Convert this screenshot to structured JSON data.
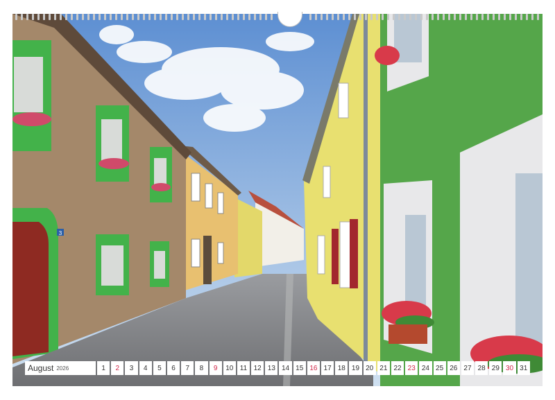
{
  "calendar": {
    "month": "August",
    "year": "2026",
    "days": [
      {
        "n": "1",
        "sun": false
      },
      {
        "n": "2",
        "sun": true
      },
      {
        "n": "3",
        "sun": false
      },
      {
        "n": "4",
        "sun": false
      },
      {
        "n": "5",
        "sun": false
      },
      {
        "n": "6",
        "sun": false
      },
      {
        "n": "7",
        "sun": false
      },
      {
        "n": "8",
        "sun": false
      },
      {
        "n": "9",
        "sun": true
      },
      {
        "n": "10",
        "sun": false
      },
      {
        "n": "11",
        "sun": false
      },
      {
        "n": "12",
        "sun": false
      },
      {
        "n": "13",
        "sun": false
      },
      {
        "n": "14",
        "sun": false
      },
      {
        "n": "15",
        "sun": false
      },
      {
        "n": "16",
        "sun": true
      },
      {
        "n": "17",
        "sun": false
      },
      {
        "n": "18",
        "sun": false
      },
      {
        "n": "19",
        "sun": false
      },
      {
        "n": "20",
        "sun": false
      },
      {
        "n": "21",
        "sun": false
      },
      {
        "n": "22",
        "sun": false
      },
      {
        "n": "23",
        "sun": true
      },
      {
        "n": "24",
        "sun": false
      },
      {
        "n": "25",
        "sun": false
      },
      {
        "n": "26",
        "sun": false
      },
      {
        "n": "27",
        "sun": false
      },
      {
        "n": "28",
        "sun": false
      },
      {
        "n": "29",
        "sun": false
      },
      {
        "n": "30",
        "sun": true
      },
      {
        "n": "31",
        "sun": false
      }
    ],
    "sunday_color": "#d0284a"
  },
  "photo": {
    "house_number": "3",
    "colors": {
      "sky": "#6f9fd8",
      "green_house": "#55a64a",
      "yellow_house": "#e8e070",
      "brown_house": "#a4886a",
      "cobblestone": "#8a8c90"
    }
  }
}
